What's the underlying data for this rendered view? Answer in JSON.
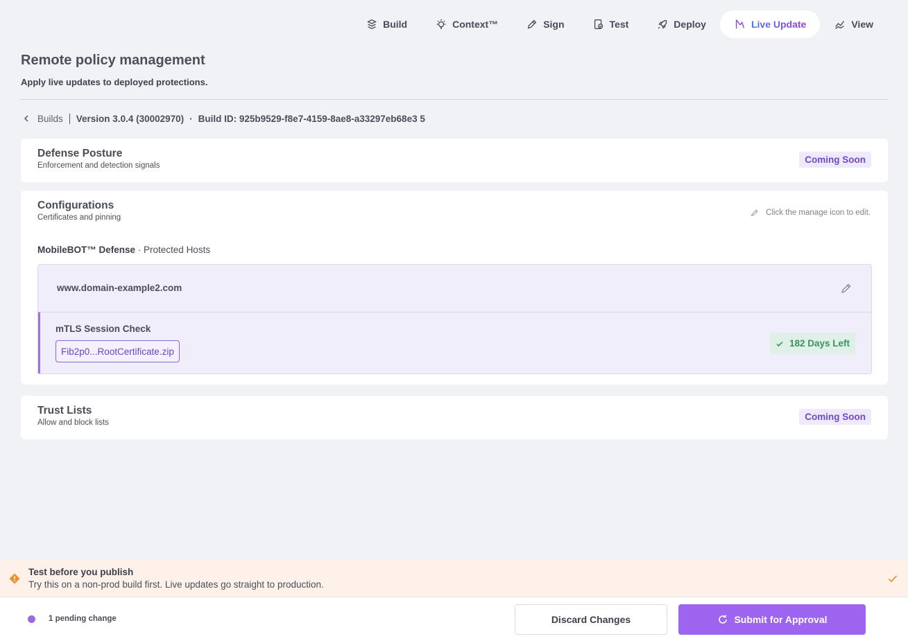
{
  "nav": {
    "items": [
      {
        "label": "Build",
        "icon": "layers-icon"
      },
      {
        "label": "Context™",
        "icon": "lightbulb-icon"
      },
      {
        "label": "Sign",
        "icon": "pen-icon"
      },
      {
        "label": "Test",
        "icon": "clipboard-check-icon"
      },
      {
        "label": "Deploy",
        "icon": "rocket-icon"
      },
      {
        "label": "Live Update",
        "icon": "live-update-icon",
        "active": true
      },
      {
        "label": "View",
        "icon": "chart-line-icon"
      }
    ],
    "active_gradient": [
      "#4a74e8",
      "#9a3fd8"
    ]
  },
  "header": {
    "title": "Remote policy management",
    "subtitle": "Apply live updates to deployed protections."
  },
  "breadcrumb": {
    "back_label": "Builds",
    "version": "Version 3.0.4 (30002970)",
    "separator": "·",
    "build_id": "Build ID: 925b9529-f8e7-4159-8ae8-a33297eb68e3 5"
  },
  "defense_posture": {
    "title": "Defense Posture",
    "subtitle": "Enforcement and detection signals",
    "badge": "Coming Soon"
  },
  "configurations": {
    "title": "Configurations",
    "subtitle": "Certificates and pinning",
    "hint": "Click the manage icon to edit.",
    "section_label_bold": "MobileBOT™ Defense",
    "section_label_rest": " · Protected Hosts",
    "host": {
      "name": "www.domain-example2.com",
      "check_title": "mTLS Session Check",
      "file": "Fib2p0...RootCertificate.zip",
      "days_left": "182 Days Left"
    }
  },
  "trust_lists": {
    "title": "Trust Lists",
    "subtitle": "Allow and block lists",
    "badge": "Coming Soon"
  },
  "warning": {
    "title": "Test before you publish",
    "text": "Try this on a non-prod build first. Live updates go straight to production."
  },
  "footer": {
    "pending": "1 pending change",
    "discard_label": "Discard Changes",
    "submit_label": "Submit for Approval"
  },
  "colors": {
    "accent": "#9d65ef",
    "badge_purple_bg": "#efeafb",
    "success_bg": "#dff1e6",
    "warning_bg": "#fdf1ea",
    "warning_icon": "#f0902c"
  }
}
